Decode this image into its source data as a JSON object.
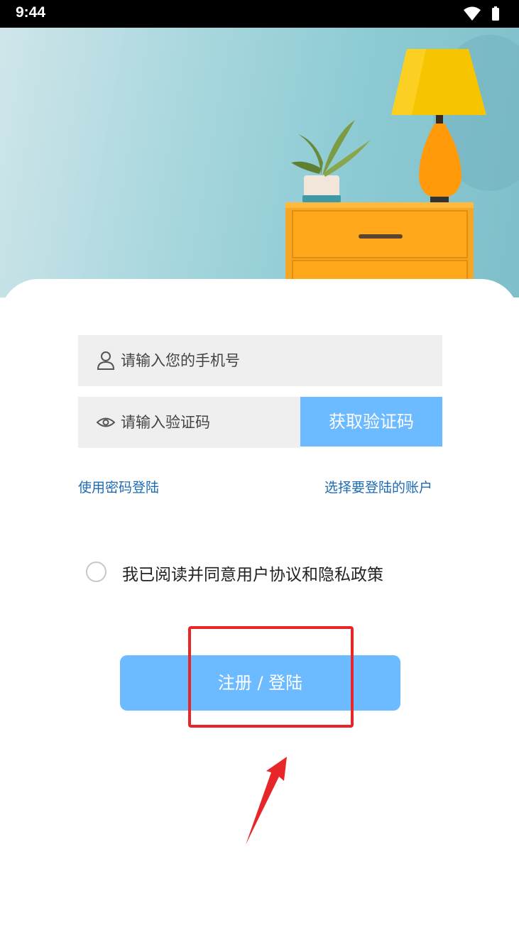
{
  "status_bar": {
    "time": "9:44"
  },
  "login": {
    "phone_placeholder": "请输入您的手机号",
    "code_placeholder": "请输入验证码",
    "get_code_label": "获取验证码",
    "password_login_link": "使用密码登陆",
    "select_account_link": "选择要登陆的账户",
    "agreement_text": "我已阅读并同意用户协议和隐私政策",
    "agreement_checked": false,
    "submit_label": "注册 / 登陆"
  },
  "colors": {
    "accent": "#6cbaff",
    "link": "#1e6bb5",
    "annotation": "#e8262a"
  }
}
